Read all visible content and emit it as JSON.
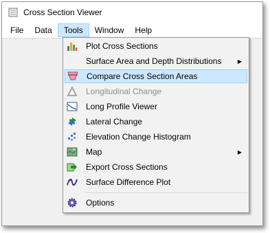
{
  "window": {
    "title": "Cross Section Viewer"
  },
  "menubar": {
    "file": "File",
    "data": "Data",
    "tools": "Tools",
    "window": "Window",
    "help": "Help"
  },
  "tools_menu": {
    "plot_cross_sections": "Plot Cross Sections",
    "surface_area": "Surface Area and Depth Distributions",
    "compare_areas": "Compare Cross Section Areas",
    "longitudinal_change": "Longitudinal Change",
    "long_profile_viewer": "Long Profile Viewer",
    "lateral_change": "Lateral Change",
    "elevation_histogram": "Elevation Change Histogram",
    "map": "Map",
    "export_cross_sections": "Export Cross Sections",
    "surface_difference": "Surface Difference Plot",
    "options": "Options"
  },
  "icons": {
    "plot": "bar-chart-icon",
    "surface_area": "none",
    "compare": "cross-section-area-icon",
    "longitudinal": "delta-icon",
    "long_profile": "profile-chart-icon",
    "lateral": "lateral-arrows-icon",
    "histogram": "histogram-icon",
    "map": "map-icon",
    "export": "export-arrow-icon",
    "surface_difference": "wave-icon",
    "options": "gear-icon"
  },
  "colors": {
    "highlight": "#cce8ff",
    "highlight_border": "#99d1ff",
    "disabled_text": "#8d8d8d"
  }
}
